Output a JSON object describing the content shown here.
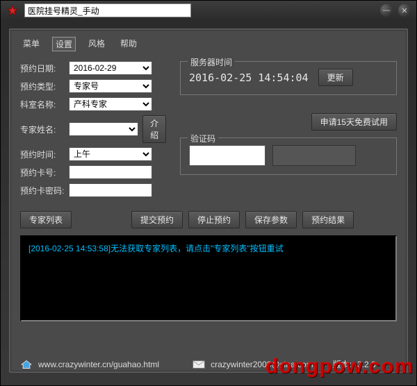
{
  "window": {
    "title": "医院挂号精灵_手动"
  },
  "menu": {
    "items": [
      "菜单",
      "设置",
      "风格",
      "帮助"
    ],
    "active_index": 1
  },
  "form": {
    "date": {
      "label": "预约日期:",
      "value": "2016-02-29"
    },
    "type": {
      "label": "预约类型:",
      "value": "专家号"
    },
    "dept": {
      "label": "科室名称:",
      "value": "产科专家"
    },
    "expert": {
      "label": "专家姓名:",
      "value": ""
    },
    "intro_btn": "介绍",
    "time": {
      "label": "预约时间:",
      "value": "上午"
    },
    "card": {
      "label": "预约卡号:",
      "value": ""
    },
    "pwd": {
      "label": "预约卡密码:",
      "value": ""
    }
  },
  "server": {
    "legend": "服务器时间",
    "value": "2016-02-25 14:54:04",
    "refresh": "更新"
  },
  "trial_btn": "申请15天免费试用",
  "captcha": {
    "legend": "验证码"
  },
  "buttons": {
    "expert_list": "专家列表",
    "submit": "提交预约",
    "stop": "停止预约",
    "save": "保存参数",
    "result": "预约结果"
  },
  "log": {
    "line1": "[2016-02-25 14:53:58]无法获取专家列表，请点击\"专家列表\"按钮重试"
  },
  "footer": {
    "url": "www.crazywinter.cn/guahao.html",
    "email": "crazywinter2008@sina.com",
    "version_label": "版本:",
    "version": "3.2.3"
  },
  "watermark": "dongpow.com"
}
